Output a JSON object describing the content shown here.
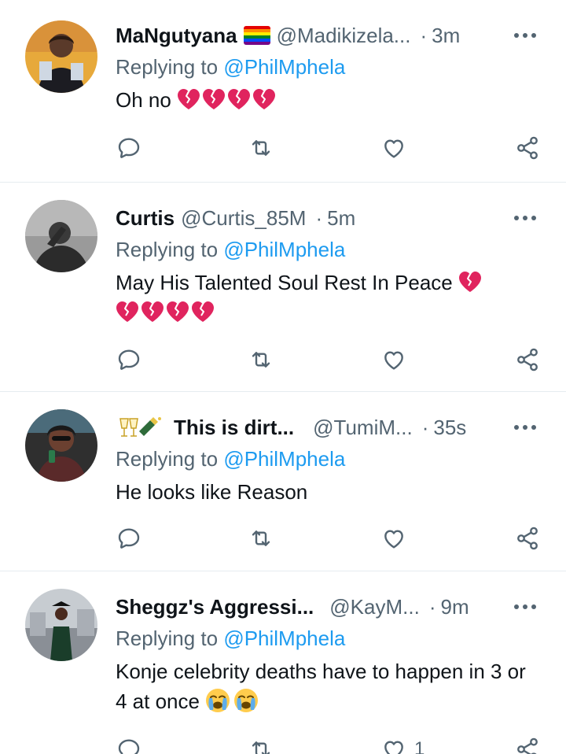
{
  "colors": {
    "accent": "#1d9bf0",
    "secondary": "#536471",
    "primary_text": "#0f1419",
    "divider": "#e6ecf0",
    "broken_heart": "#e0245e"
  },
  "tweets": [
    {
      "name": "MaNgutyana",
      "name_emoji": "rainbow-flag",
      "handle": "@Madikizela...",
      "time": "3m",
      "replying_prefix": "Replying to",
      "replying_to": "@PhilMphela",
      "text": "Oh no",
      "text_emoji": [
        "broken-heart",
        "broken-heart",
        "broken-heart",
        "broken-heart"
      ],
      "like_count": ""
    },
    {
      "name": "Curtis",
      "handle": "@Curtis_85M",
      "time": "5m",
      "replying_prefix": "Replying to",
      "replying_to": "@PhilMphela",
      "text": "May His Talented  Soul Rest In Peace",
      "text_emoji": [
        "broken-heart",
        "broken-heart",
        "broken-heart",
        "broken-heart",
        "broken-heart"
      ],
      "like_count": ""
    },
    {
      "name_prefix_emoji": [
        "clinking-glasses",
        "champagne-bottle"
      ],
      "name": "This is dirt...",
      "handle": "@TumiM...",
      "time": "35s",
      "replying_prefix": "Replying to",
      "replying_to": "@PhilMphela",
      "text": "He looks like Reason",
      "like_count": ""
    },
    {
      "name": "Sheggz's Aggressi...",
      "handle": "@KayM...",
      "time": "9m",
      "replying_prefix": "Replying to",
      "replying_to": "@PhilMphela",
      "text": "Konje celebrity deaths have to happen in 3 or 4 at once",
      "text_emoji": [
        "loudly-crying-face",
        "loudly-crying-face"
      ],
      "like_count": "1"
    }
  ],
  "separator": "·",
  "icons": {
    "reply": "reply-icon",
    "retweet": "retweet-icon",
    "like": "like-icon",
    "share": "share-icon",
    "more": "more-icon"
  }
}
